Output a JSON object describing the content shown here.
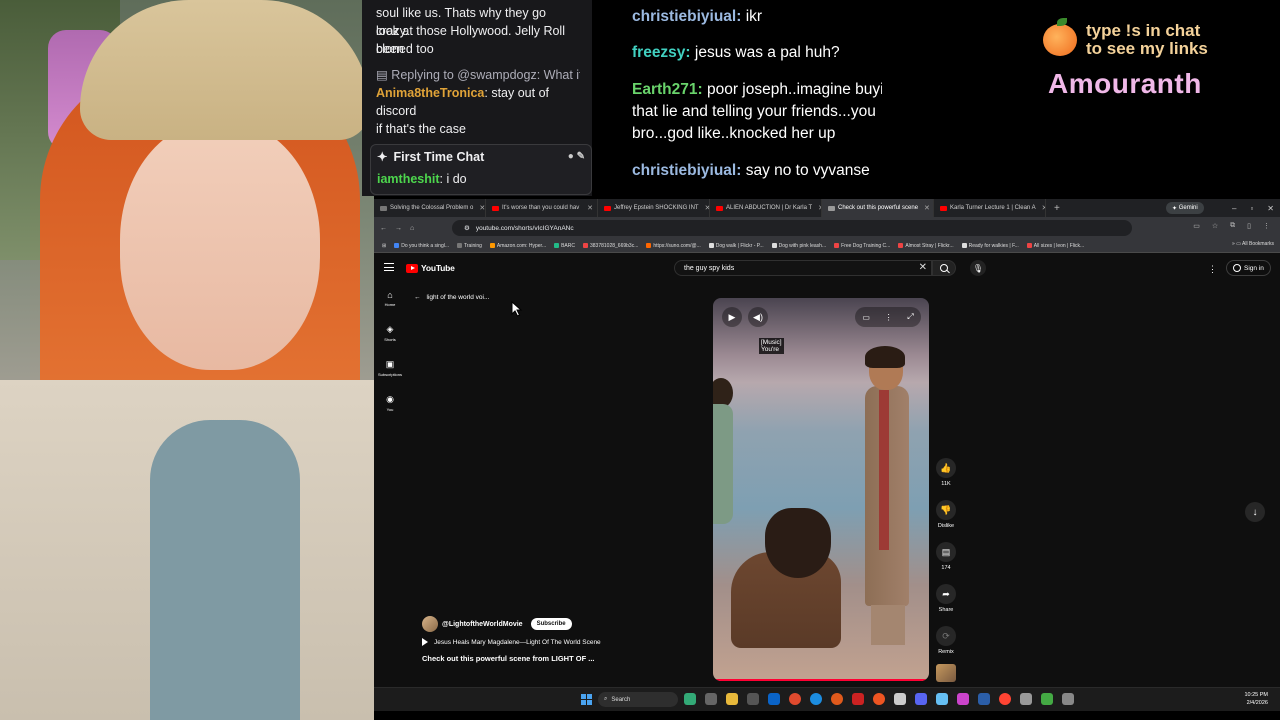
{
  "stream_chat": {
    "line1": "soul like us. Thats why they go crazy.",
    "line2": "look at those Hollywood. Jelly Roll been",
    "line3": "cloned too",
    "reply_to": "Replying to @swampdogz: What if ...",
    "anima_user": "Anima8theTronica",
    "anima_msg": ": stay out of discord",
    "anima_msg2": "if that's the case",
    "first_time_chat_label": "First Time Chat",
    "first_time_user": "iamtheshit",
    "first_time_msg": ": i do"
  },
  "overlay_chat": [
    {
      "user": "christiebiyiual:",
      "text": " ikr"
    },
    {
      "user": "freezsy:",
      "text": " jesus was a pal huh?"
    },
    {
      "user": "Earth271:",
      "text": " poor joseph..imagine buying"
    },
    {
      "text2": "that lie and telling your friends...you"
    },
    {
      "text3": "bro...god like..knocked her up"
    },
    {
      "user": "christiebiyiual:",
      "text": " say no to vyvanse"
    }
  ],
  "promo": {
    "line1": "type !s in chat",
    "line2": "to see my links",
    "name": "Amouranth"
  },
  "browser": {
    "tabs": [
      {
        "label": "Solving the Colossal Problem o",
        "icon": "generic"
      },
      {
        "label": "It's worse than you could hav",
        "icon": "youtube"
      },
      {
        "label": "Jeffrey Epstein SHOCKING INT",
        "icon": "youtube"
      },
      {
        "label": "ALIEN ABDUCTION | Dr Karla T",
        "icon": "youtube"
      },
      {
        "label": "Check out this powerful scene",
        "icon": "generic"
      },
      {
        "label": "Karla Turner Lecture 1 | Clean A",
        "icon": "youtube"
      }
    ],
    "gemini_label": "Gemini",
    "url": "youtube.com/shorts/vIcIGYAnANc",
    "bookmarks": [
      "Do you think a singl...",
      "Training",
      "Amazon.com: Hyper...",
      "BARC",
      "383781028_669b3c...",
      "https://suno.com/@...",
      "Dog walk | Flickr - P...",
      "Dog with pink leash...",
      "Free Dog Training C...",
      "Almost Stray | Flickr...",
      "Ready for walkies | F...",
      "All sizes | leon | Flick..."
    ],
    "all_bookmarks": "All Bookmarks"
  },
  "youtube": {
    "logo_text": "YouTube",
    "search_query": "the guy spy kids",
    "sign_in": "Sign in",
    "sidebar": [
      "Home",
      "Shorts",
      "Subscriptions",
      "You"
    ],
    "back_label": "light of the world voi...",
    "caption_line1": "[Music]",
    "caption_line2": "You're",
    "like_count": "11K",
    "dislike_label": "Dislike",
    "comment_count": "174",
    "share_label": "Share",
    "remix_label": "Remix",
    "channel": "@LightoftheWorldMovie",
    "subscribe": "Subscribe",
    "song": "Jesus Heals Mary Magdalene—Light Of The World Scene",
    "description": "Check out this powerful scene from LIGHT OF ..."
  },
  "taskbar": {
    "search": "Search",
    "time": "10:25 PM",
    "date": "2/4/2026"
  }
}
